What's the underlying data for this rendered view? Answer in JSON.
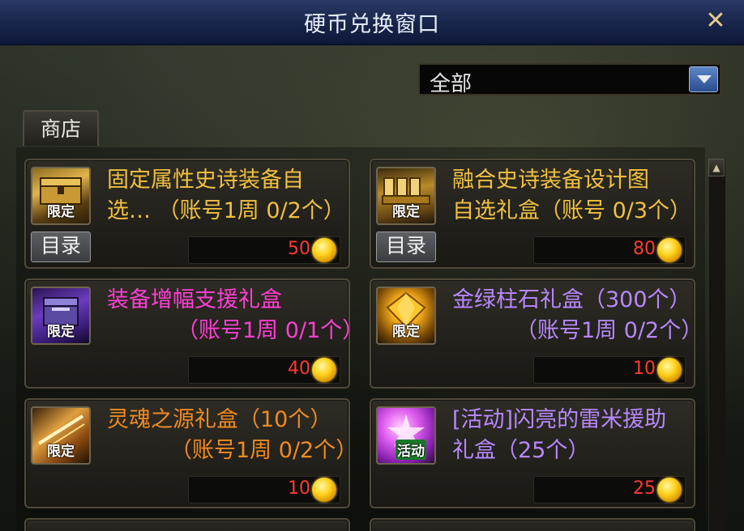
{
  "window": {
    "title": "硬币兑换窗口",
    "close_label": "✕"
  },
  "filter": {
    "selected": "全部"
  },
  "tabs": [
    {
      "label": "商店"
    }
  ],
  "catalog_label": "目录",
  "items": [
    {
      "name_line1": "固定属性史诗装备自",
      "name_line2": "选… （账号1周 0/2个）",
      "badge": "限定",
      "price": "50",
      "color": "#f0c040",
      "has_catalog": true
    },
    {
      "name_line1": "融合史诗装备设计图",
      "name_line2": "自选礼盒（账号 0/3个）",
      "badge": "限定",
      "price": "80",
      "color": "#f0c040",
      "has_catalog": true
    },
    {
      "name_line1": "装备增幅支援礼盒",
      "name_line2": "（账号1周 0/1个）",
      "badge": "限定",
      "price": "40",
      "color": "#ff3fd4",
      "has_catalog": false
    },
    {
      "name_line1": "金绿柱石礼盒（300个）",
      "name_line2": "（账号1周 0/2个）",
      "badge": "限定",
      "price": "10",
      "color": "#b888ff",
      "has_catalog": false
    },
    {
      "name_line1": "灵魂之源礼盒（10个）",
      "name_line2": "（账号1周 0/2个）",
      "badge": "限定",
      "price": "10",
      "color": "#f08a20",
      "has_catalog": false
    },
    {
      "name_line1": "[活动]闪亮的雷米援助",
      "name_line2": "礼盒（25个）",
      "badge": "活动",
      "price": "25",
      "color": "#b888ff",
      "has_catalog": false
    }
  ]
}
